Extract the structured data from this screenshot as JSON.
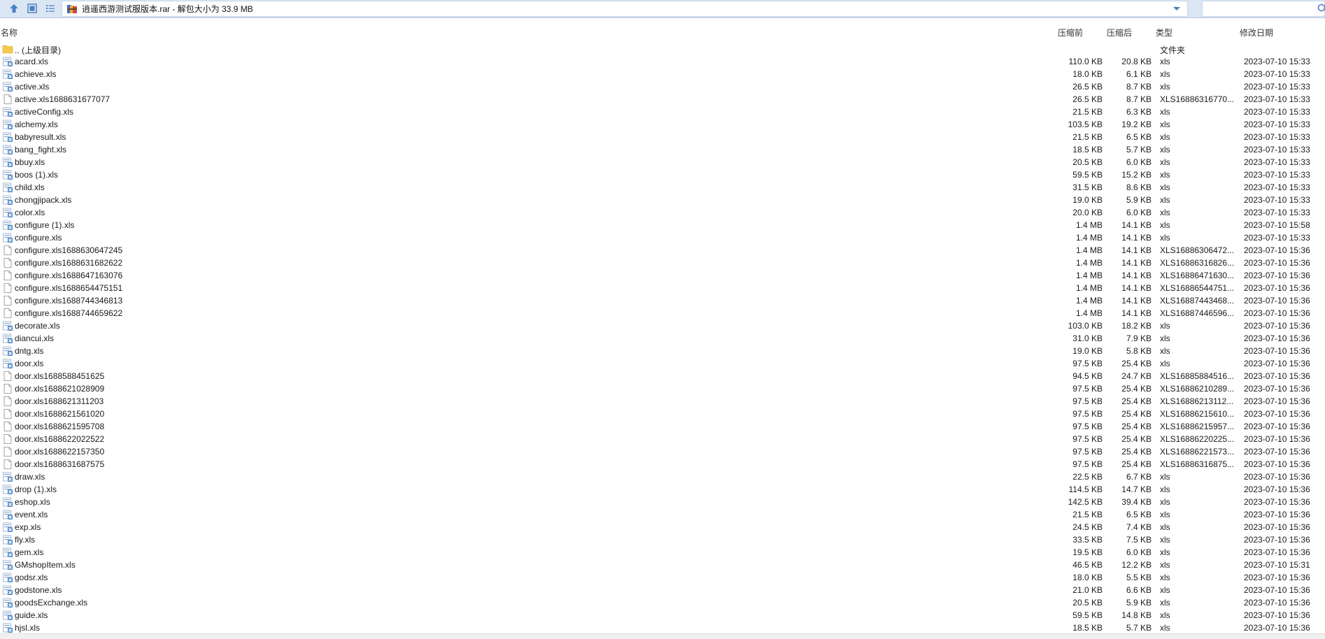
{
  "toolbar": {
    "address": "逍遥西游测试服版本.rar - 解包大小为 33.9 MB"
  },
  "columns": {
    "name": "名称",
    "size_before": "压缩前",
    "size_after": "压缩后",
    "type": "类型",
    "modified": "修改日期"
  },
  "colors": {
    "toolbar_bg": "#dbe6f4",
    "folder_icon": "#f5c94c",
    "xls_icon": "#4a86c8"
  },
  "files": [
    {
      "icon": "folder-icon",
      "name": ".. (上级目录)",
      "before": "",
      "after": "",
      "type": "文件夹",
      "date": ""
    },
    {
      "icon": "xls-icon",
      "name": "acard.xls",
      "before": "110.0 KB",
      "after": "20.8 KB",
      "type": "xls",
      "date": "2023-07-10 15:33"
    },
    {
      "icon": "xls-icon",
      "name": "achieve.xls",
      "before": "18.0 KB",
      "after": "6.1 KB",
      "type": "xls",
      "date": "2023-07-10 15:33"
    },
    {
      "icon": "xls-icon",
      "name": "active.xls",
      "before": "26.5 KB",
      "after": "8.7 KB",
      "type": "xls",
      "date": "2023-07-10 15:33"
    },
    {
      "icon": "file-icon",
      "name": "active.xls1688631677077",
      "before": "26.5 KB",
      "after": "8.7 KB",
      "type": "XLS16886316770...",
      "date": "2023-07-10 15:33"
    },
    {
      "icon": "xls-icon",
      "name": "activeConfig.xls",
      "before": "21.5 KB",
      "after": "6.3 KB",
      "type": "xls",
      "date": "2023-07-10 15:33"
    },
    {
      "icon": "xls-icon",
      "name": "alchemy.xls",
      "before": "103.5 KB",
      "after": "19.2 KB",
      "type": "xls",
      "date": "2023-07-10 15:33"
    },
    {
      "icon": "xls-icon",
      "name": "babyresult.xls",
      "before": "21.5 KB",
      "after": "6.5 KB",
      "type": "xls",
      "date": "2023-07-10 15:33"
    },
    {
      "icon": "xls-icon",
      "name": "bang_fight.xls",
      "before": "18.5 KB",
      "after": "5.7 KB",
      "type": "xls",
      "date": "2023-07-10 15:33"
    },
    {
      "icon": "xls-icon",
      "name": "bbuy.xls",
      "before": "20.5 KB",
      "after": "6.0 KB",
      "type": "xls",
      "date": "2023-07-10 15:33"
    },
    {
      "icon": "xls-icon",
      "name": "boos (1).xls",
      "before": "59.5 KB",
      "after": "15.2 KB",
      "type": "xls",
      "date": "2023-07-10 15:33"
    },
    {
      "icon": "xls-icon",
      "name": "child.xls",
      "before": "31.5 KB",
      "after": "8.6 KB",
      "type": "xls",
      "date": "2023-07-10 15:33"
    },
    {
      "icon": "xls-icon",
      "name": "chongjipack.xls",
      "before": "19.0 KB",
      "after": "5.9 KB",
      "type": "xls",
      "date": "2023-07-10 15:33"
    },
    {
      "icon": "xls-icon",
      "name": "color.xls",
      "before": "20.0 KB",
      "after": "6.0 KB",
      "type": "xls",
      "date": "2023-07-10 15:33"
    },
    {
      "icon": "xls-icon",
      "name": "configure (1).xls",
      "before": "1.4 MB",
      "after": "14.1 KB",
      "type": "xls",
      "date": "2023-07-10 15:58"
    },
    {
      "icon": "xls-icon",
      "name": "configure.xls",
      "before": "1.4 MB",
      "after": "14.1 KB",
      "type": "xls",
      "date": "2023-07-10 15:33"
    },
    {
      "icon": "file-icon",
      "name": "configure.xls1688630647245",
      "before": "1.4 MB",
      "after": "14.1 KB",
      "type": "XLS16886306472...",
      "date": "2023-07-10 15:36"
    },
    {
      "icon": "file-icon",
      "name": "configure.xls1688631682622",
      "before": "1.4 MB",
      "after": "14.1 KB",
      "type": "XLS16886316826...",
      "date": "2023-07-10 15:36"
    },
    {
      "icon": "file-icon",
      "name": "configure.xls1688647163076",
      "before": "1.4 MB",
      "after": "14.1 KB",
      "type": "XLS16886471630...",
      "date": "2023-07-10 15:36"
    },
    {
      "icon": "file-icon",
      "name": "configure.xls1688654475151",
      "before": "1.4 MB",
      "after": "14.1 KB",
      "type": "XLS16886544751...",
      "date": "2023-07-10 15:36"
    },
    {
      "icon": "file-icon",
      "name": "configure.xls1688744346813",
      "before": "1.4 MB",
      "after": "14.1 KB",
      "type": "XLS16887443468...",
      "date": "2023-07-10 15:36"
    },
    {
      "icon": "file-icon",
      "name": "configure.xls1688744659622",
      "before": "1.4 MB",
      "after": "14.1 KB",
      "type": "XLS16887446596...",
      "date": "2023-07-10 15:36"
    },
    {
      "icon": "xls-icon",
      "name": "decorate.xls",
      "before": "103.0 KB",
      "after": "18.2 KB",
      "type": "xls",
      "date": "2023-07-10 15:36"
    },
    {
      "icon": "xls-icon",
      "name": "diancui.xls",
      "before": "31.0 KB",
      "after": "7.9 KB",
      "type": "xls",
      "date": "2023-07-10 15:36"
    },
    {
      "icon": "xls-icon",
      "name": "dntg.xls",
      "before": "19.0 KB",
      "after": "5.8 KB",
      "type": "xls",
      "date": "2023-07-10 15:36"
    },
    {
      "icon": "xls-icon",
      "name": "door.xls",
      "before": "97.5 KB",
      "after": "25.4 KB",
      "type": "xls",
      "date": "2023-07-10 15:36"
    },
    {
      "icon": "file-icon",
      "name": "door.xls1688588451625",
      "before": "94.5 KB",
      "after": "24.7 KB",
      "type": "XLS16885884516...",
      "date": "2023-07-10 15:36"
    },
    {
      "icon": "file-icon",
      "name": "door.xls1688621028909",
      "before": "97.5 KB",
      "after": "25.4 KB",
      "type": "XLS16886210289...",
      "date": "2023-07-10 15:36"
    },
    {
      "icon": "file-icon",
      "name": "door.xls1688621311203",
      "before": "97.5 KB",
      "after": "25.4 KB",
      "type": "XLS16886213112...",
      "date": "2023-07-10 15:36"
    },
    {
      "icon": "file-icon",
      "name": "door.xls1688621561020",
      "before": "97.5 KB",
      "after": "25.4 KB",
      "type": "XLS16886215610...",
      "date": "2023-07-10 15:36"
    },
    {
      "icon": "file-icon",
      "name": "door.xls1688621595708",
      "before": "97.5 KB",
      "after": "25.4 KB",
      "type": "XLS16886215957...",
      "date": "2023-07-10 15:36"
    },
    {
      "icon": "file-icon",
      "name": "door.xls1688622022522",
      "before": "97.5 KB",
      "after": "25.4 KB",
      "type": "XLS16886220225...",
      "date": "2023-07-10 15:36"
    },
    {
      "icon": "file-icon",
      "name": "door.xls1688622157350",
      "before": "97.5 KB",
      "after": "25.4 KB",
      "type": "XLS16886221573...",
      "date": "2023-07-10 15:36"
    },
    {
      "icon": "file-icon",
      "name": "door.xls1688631687575",
      "before": "97.5 KB",
      "after": "25.4 KB",
      "type": "XLS16886316875...",
      "date": "2023-07-10 15:36"
    },
    {
      "icon": "xls-icon",
      "name": "draw.xls",
      "before": "22.5 KB",
      "after": "6.7 KB",
      "type": "xls",
      "date": "2023-07-10 15:36"
    },
    {
      "icon": "xls-icon",
      "name": "drop (1).xls",
      "before": "114.5 KB",
      "after": "14.7 KB",
      "type": "xls",
      "date": "2023-07-10 15:36"
    },
    {
      "icon": "xls-icon",
      "name": "eshop.xls",
      "before": "142.5 KB",
      "after": "39.4 KB",
      "type": "xls",
      "date": "2023-07-10 15:36"
    },
    {
      "icon": "xls-icon",
      "name": "event.xls",
      "before": "21.5 KB",
      "after": "6.5 KB",
      "type": "xls",
      "date": "2023-07-10 15:36"
    },
    {
      "icon": "xls-icon",
      "name": "exp.xls",
      "before": "24.5 KB",
      "after": "7.4 KB",
      "type": "xls",
      "date": "2023-07-10 15:36"
    },
    {
      "icon": "xls-icon",
      "name": "fly.xls",
      "before": "33.5 KB",
      "after": "7.5 KB",
      "type": "xls",
      "date": "2023-07-10 15:36"
    },
    {
      "icon": "xls-icon",
      "name": "gem.xls",
      "before": "19.5 KB",
      "after": "6.0 KB",
      "type": "xls",
      "date": "2023-07-10 15:36"
    },
    {
      "icon": "xls-icon",
      "name": "GMshopItem.xls",
      "before": "46.5 KB",
      "after": "12.2 KB",
      "type": "xls",
      "date": "2023-07-10 15:31"
    },
    {
      "icon": "xls-icon",
      "name": "godsr.xls",
      "before": "18.0 KB",
      "after": "5.5 KB",
      "type": "xls",
      "date": "2023-07-10 15:36"
    },
    {
      "icon": "xls-icon",
      "name": "godstone.xls",
      "before": "21.0 KB",
      "after": "6.6 KB",
      "type": "xls",
      "date": "2023-07-10 15:36"
    },
    {
      "icon": "xls-icon",
      "name": "goodsExchange.xls",
      "before": "20.5 KB",
      "after": "5.9 KB",
      "type": "xls",
      "date": "2023-07-10 15:36"
    },
    {
      "icon": "xls-icon",
      "name": "guide.xls",
      "before": "59.5 KB",
      "after": "14.8 KB",
      "type": "xls",
      "date": "2023-07-10 15:36"
    },
    {
      "icon": "xls-icon",
      "name": "hjsl.xls",
      "before": "18.5 KB",
      "after": "5.7 KB",
      "type": "xls",
      "date": "2023-07-10 15:36"
    }
  ]
}
